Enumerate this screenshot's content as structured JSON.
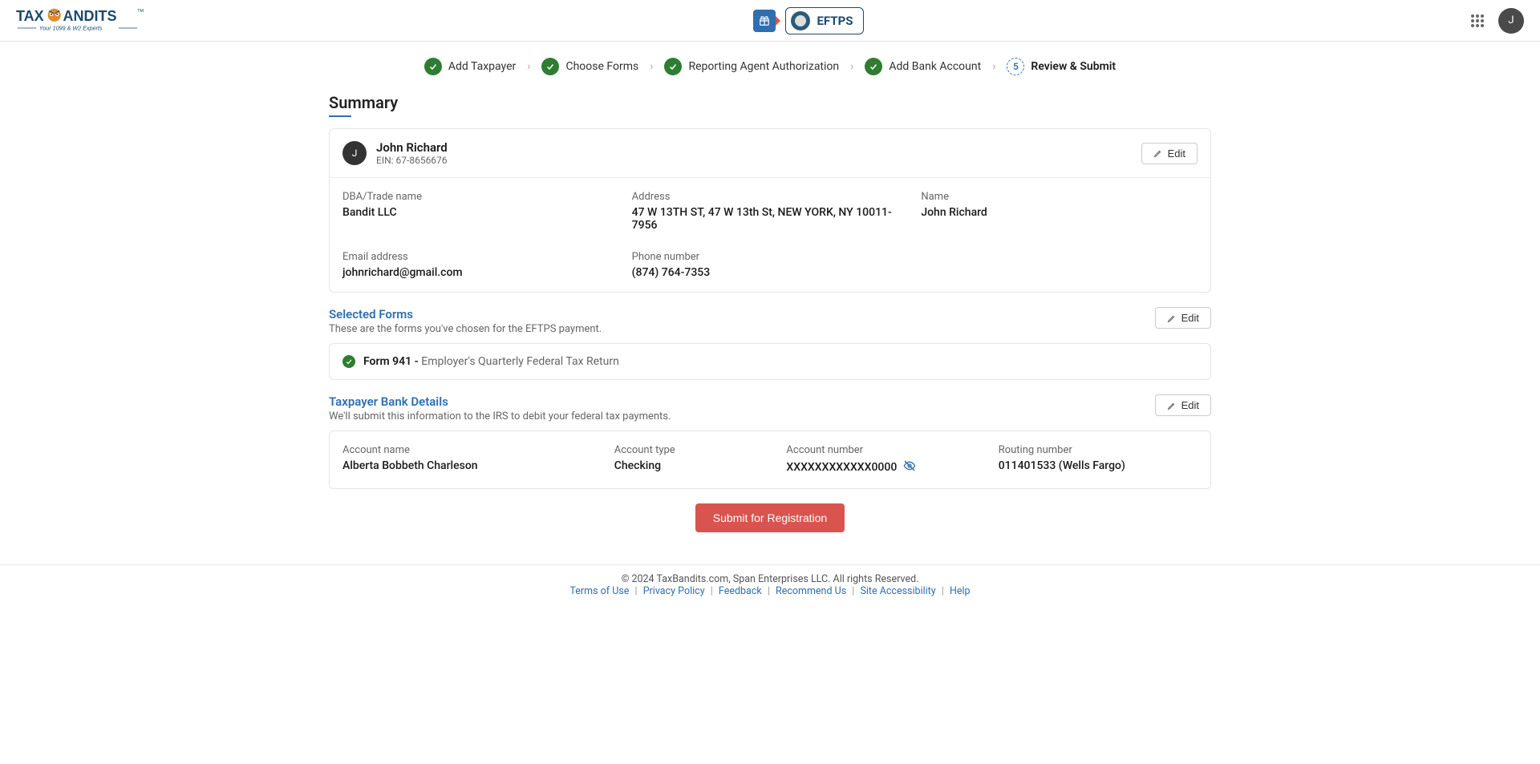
{
  "header": {
    "product_label": "EFTPS",
    "avatar_initial": "J"
  },
  "stepper": {
    "steps": [
      {
        "label": "Add Taxpayer",
        "state": "done"
      },
      {
        "label": "Choose Forms",
        "state": "done"
      },
      {
        "label": "Reporting Agent Authorization",
        "state": "done"
      },
      {
        "label": "Add Bank Account",
        "state": "done"
      },
      {
        "label": "Review & Submit",
        "state": "current",
        "num": "5"
      }
    ]
  },
  "page": {
    "title": "Summary"
  },
  "taxpayer": {
    "avatar_initial": "J",
    "name": "John Richard",
    "ein_label": "EIN: 67-8656676",
    "edit_label": "Edit",
    "fields": {
      "dba_label": "DBA/Trade name",
      "dba_value": "Bandit LLC",
      "address_label": "Address",
      "address_value": "47 W 13TH ST, 47 W 13th St, NEW YORK, NY 10011-7956",
      "name_label": "Name",
      "name_value": "John Richard",
      "email_label": "Email address",
      "email_value": "johnrichard@gmail.com",
      "phone_label": "Phone number",
      "phone_value": "(874) 764-7353"
    }
  },
  "forms_section": {
    "title": "Selected Forms",
    "subtitle": "These are the forms you've chosen for the EFTPS payment.",
    "edit_label": "Edit",
    "item": {
      "code": "Form 941 - ",
      "desc": "Employer's Quarterly Federal Tax Return"
    }
  },
  "bank_section": {
    "title": "Taxpayer Bank Details",
    "subtitle": "We'll submit this information to the IRS to debit your federal tax payments.",
    "edit_label": "Edit",
    "fields": {
      "acct_name_label": "Account name",
      "acct_name_value": "Alberta Bobbeth Charleson",
      "acct_type_label": "Account type",
      "acct_type_value": "Checking",
      "acct_num_label": "Account number",
      "acct_num_value": "XXXXXXXXXXXX0000",
      "routing_label": "Routing number",
      "routing_value": "011401533 (Wells Fargo)"
    }
  },
  "actions": {
    "submit_label": "Submit for Registration"
  },
  "footer": {
    "copyright": "© 2024 TaxBandits.com, Span Enterprises LLC. All rights Reserved.",
    "links": {
      "terms": "Terms of Use",
      "privacy": "Privacy Policy",
      "feedback": "Feedback",
      "recommend": "Recommend Us",
      "accessibility": "Site Accessibility",
      "help": "Help"
    }
  }
}
